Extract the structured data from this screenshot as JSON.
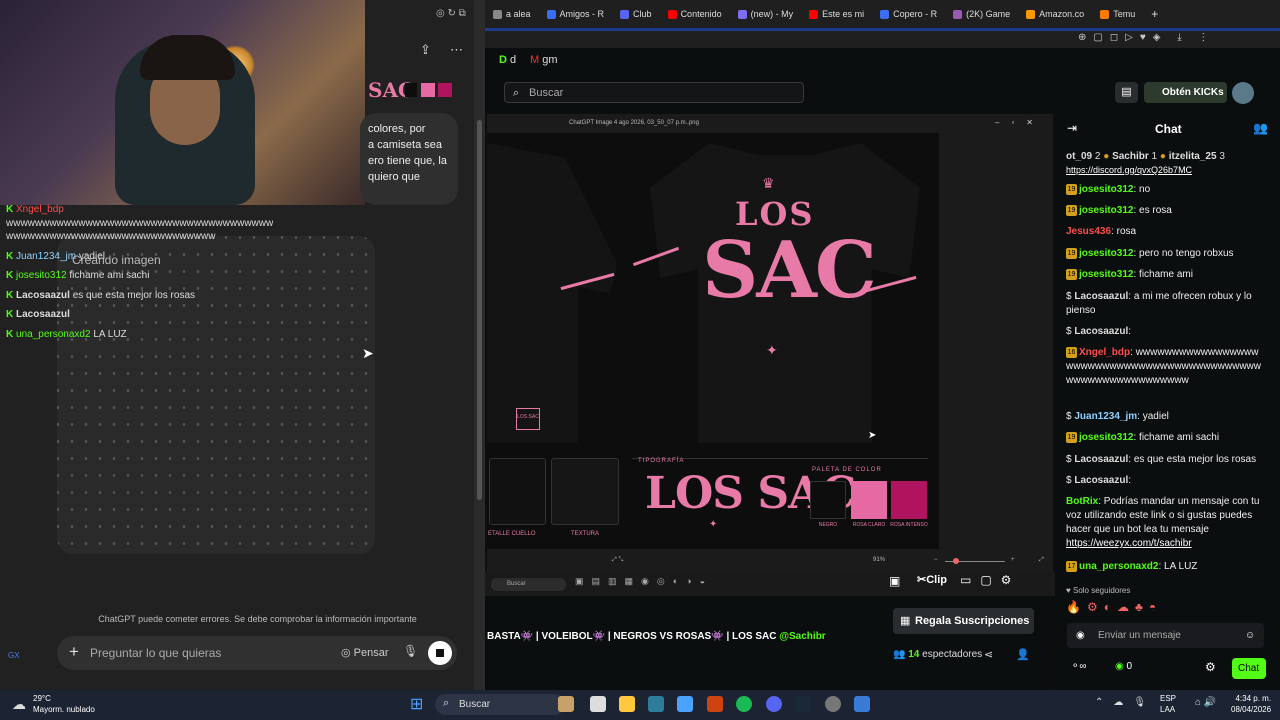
{
  "browser": {
    "tabs": [
      {
        "label": "a alea",
        "color": "#888"
      },
      {
        "label": "Amigos - R",
        "color": "#3b6ef5"
      },
      {
        "label": "Club",
        "color": "#5865f2"
      },
      {
        "label": "Contenido",
        "color": "#ff0000"
      },
      {
        "label": "(new) - My",
        "color": "#7b6ef5"
      },
      {
        "label": "Este es mi",
        "color": "#ff0000"
      },
      {
        "label": "Copero - R",
        "color": "#3b6ef5"
      },
      {
        "label": "(2K) Game",
        "color": "#9b59b6"
      },
      {
        "label": "Amazon.co",
        "color": "#ff9900"
      },
      {
        "label": "Temu",
        "color": "#ff7a00"
      }
    ],
    "new_tab": "+",
    "bookmarks": [
      "d",
      "gm"
    ]
  },
  "chatgpt": {
    "reply_lines": [
      "colores, por",
      "a camiseta sea",
      "ero tiene que, la",
      "quiero que"
    ],
    "creating_image": "Creando imagen",
    "disclaimer": "ChatGPT puede cometer errores. Se debe comprobar la información importante",
    "input_placeholder": "Preguntar lo que quieras",
    "think_label": "Pensar",
    "plus": "+"
  },
  "overlay_chat": [
    {
      "user": "Xngel_bdp",
      "text": "",
      "color": "#ff4d4d"
    },
    {
      "user": "",
      "text": "wwwwwwwwwwwwwwwwwwwwwwwwwwwwwwwwwwwww",
      "color": "#ddd"
    },
    {
      "user": "",
      "text": "wwwwwwwwwwwwwwwwwwwwwwwwwwwww",
      "color": "#ddd"
    },
    {
      "user": "Juan1234_jm",
      "text": "yadiel",
      "color": "#8fd0ff"
    },
    {
      "user": "josesito312",
      "text": "fichame ami sachi",
      "color": "#53fc18"
    },
    {
      "user": "Lacosaazul",
      "text": "es que esta mejor los rosas",
      "color": "#ddd"
    },
    {
      "user": "Lacosaazul",
      "text": "",
      "color": "#ddd"
    },
    {
      "user": "una_personaxd2",
      "text": "LA LUZ",
      "color": "#53fc18"
    }
  ],
  "kick": {
    "search_placeholder": "Buscar",
    "get_kicks": "Obtén KICKs",
    "gift_subs": "Regala Suscripciones",
    "stream_title": "BASTA👾 | VOLEIBOL👾 | NEGROS VS ROSAS👾 | LOS SAC",
    "stream_mention": "@Sachibr",
    "viewers": "14",
    "viewers_label": "espectadores",
    "clip": "Clip"
  },
  "viewer": {
    "filename": "ChatGPT Image 4 ago 2026, 03_50_07 p.m..png",
    "zoom": "91%",
    "design": {
      "los": "LOS",
      "sac": "SAC",
      "tipografia": "TIPOGRAFÍA",
      "logo_text": "LOS SAC",
      "paleta": "PALETA DE COLOR",
      "swatches": [
        {
          "name": "NEGRO",
          "color": "#0d0d0d"
        },
        {
          "name": "ROSA CLARO",
          "color": "#e56aa4"
        },
        {
          "name": "ROSA INTENSO",
          "color": "#b0145e"
        }
      ],
      "detalle": "ETALLE CUELLO",
      "textura": "TEXTURA"
    }
  },
  "chat": {
    "title": "Chat",
    "top_gifters": [
      {
        "name": "ot_09",
        "count": "2"
      },
      {
        "name": "Sachibr",
        "count": "1"
      },
      {
        "name": "itzelita_25",
        "count": "3"
      }
    ],
    "link_top": "https://discord.gg/qvxQ26b7MC",
    "messages": [
      {
        "user": "josesito312",
        "text": "no",
        "badge": "19",
        "cls": "u-g"
      },
      {
        "user": "josesito312",
        "text": "es rosa",
        "badge": "19",
        "cls": "u-g"
      },
      {
        "user": "Jesus436",
        "text": "rosa",
        "badge": "",
        "cls": "u-r"
      },
      {
        "user": "josesito312",
        "text": "pero no tengo robxus",
        "badge": "19",
        "cls": "u-g"
      },
      {
        "user": "josesito312",
        "text": "fichame ami",
        "badge": "19",
        "cls": "u-g"
      },
      {
        "user": "Lacosaazul",
        "text": "a mi me ofrecen robux y lo pienso",
        "badge": "",
        "cls": "u-w"
      },
      {
        "user": "Lacosaazul",
        "text": "",
        "badge": "",
        "cls": "u-w"
      },
      {
        "user": "Xngel_bdp",
        "text": "wwwwwwwwwwwwwwwwwwwwwwwwwwwwwwwwwwwwwwwwwwwwwwwwwwwwwwwwwwwww",
        "badge": "16",
        "cls": "u-r"
      },
      {
        "user": "Juan1234_jm",
        "text": "yadiel",
        "badge": "",
        "cls": "u-b"
      },
      {
        "user": "josesito312",
        "text": "fichame ami sachi",
        "badge": "19",
        "cls": "u-g"
      },
      {
        "user": "Lacosaazul",
        "text": "es que esta mejor los rosas",
        "badge": "",
        "cls": "u-w"
      },
      {
        "user": "Lacosaazul",
        "text": "",
        "badge": "",
        "cls": "u-w"
      },
      {
        "user": "BotRix",
        "text": "Podrías mandar un mensaje con tu voz utilizando este link o si gustas puedes hacer que un bot lea tu mensaje",
        "badge": "",
        "cls": "u-g",
        "link": "https://weezyx.com/t/sachibr"
      },
      {
        "user": "una_personaxd2",
        "text": "LA LUZ",
        "badge": "17",
        "cls": "u-g"
      }
    ],
    "followers_only": "Solo seguidores",
    "input_placeholder": "Enviar un mensaje",
    "send": "Chat",
    "points": "0"
  },
  "taskbar": {
    "temp": "29°C",
    "weather": "Mayorm. nublado",
    "search": "Buscar",
    "lang1": "ESP",
    "lang2": "LAA",
    "time": "4:34 p. m.",
    "date": "08/04/2026"
  }
}
